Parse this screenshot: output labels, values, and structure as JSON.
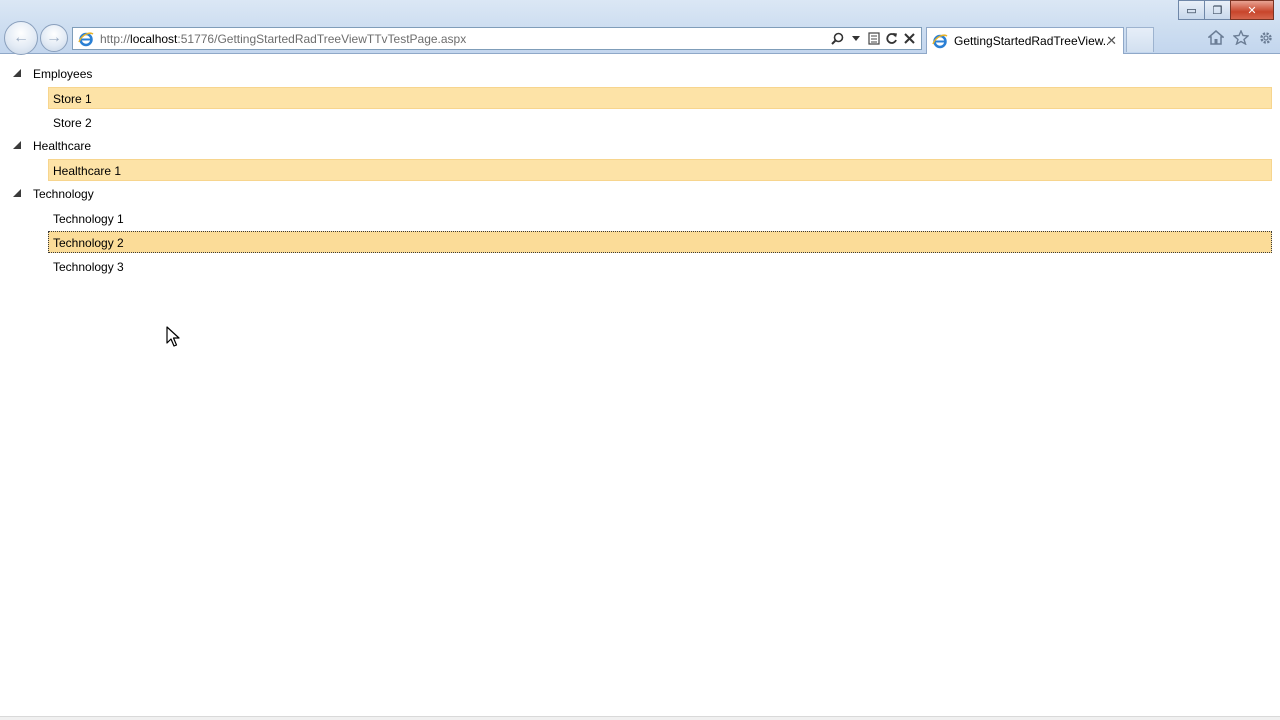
{
  "browser": {
    "url_prefix": "http://",
    "url_host": "localhost",
    "url_rest": ":51776/GettingStartedRadTreeViewTTvTestPage.aspx",
    "tab_title": "GettingStartedRadTreeView...",
    "icons": [
      "back-arrow-icon",
      "forward-arrow-icon",
      "ie-logo-icon",
      "search-icon",
      "dropdown-icon",
      "compat-view-icon",
      "refresh-icon",
      "stop-icon",
      "close-tab-icon",
      "home-icon",
      "star-icon",
      "gear-icon"
    ]
  },
  "window_controls": {
    "minimize": "▭",
    "restore": "❐",
    "close": "✕"
  },
  "tree": {
    "nodes": [
      {
        "label": "Employees",
        "expanded": true,
        "children": [
          {
            "label": "Store 1",
            "state": "selected"
          },
          {
            "label": "Store 2",
            "state": "normal"
          }
        ]
      },
      {
        "label": "Healthcare",
        "expanded": true,
        "children": [
          {
            "label": "Healthcare 1",
            "state": "selected"
          }
        ]
      },
      {
        "label": "Technology",
        "expanded": true,
        "children": [
          {
            "label": "Technology 1",
            "state": "normal"
          },
          {
            "label": "Technology 2",
            "state": "selected-focused"
          },
          {
            "label": "Technology 3",
            "state": "normal"
          }
        ]
      }
    ]
  },
  "colors": {
    "selected_bg": "#fde3a7",
    "selected_border": "#f7d58e",
    "chrome_bg": "#cfdff1"
  }
}
